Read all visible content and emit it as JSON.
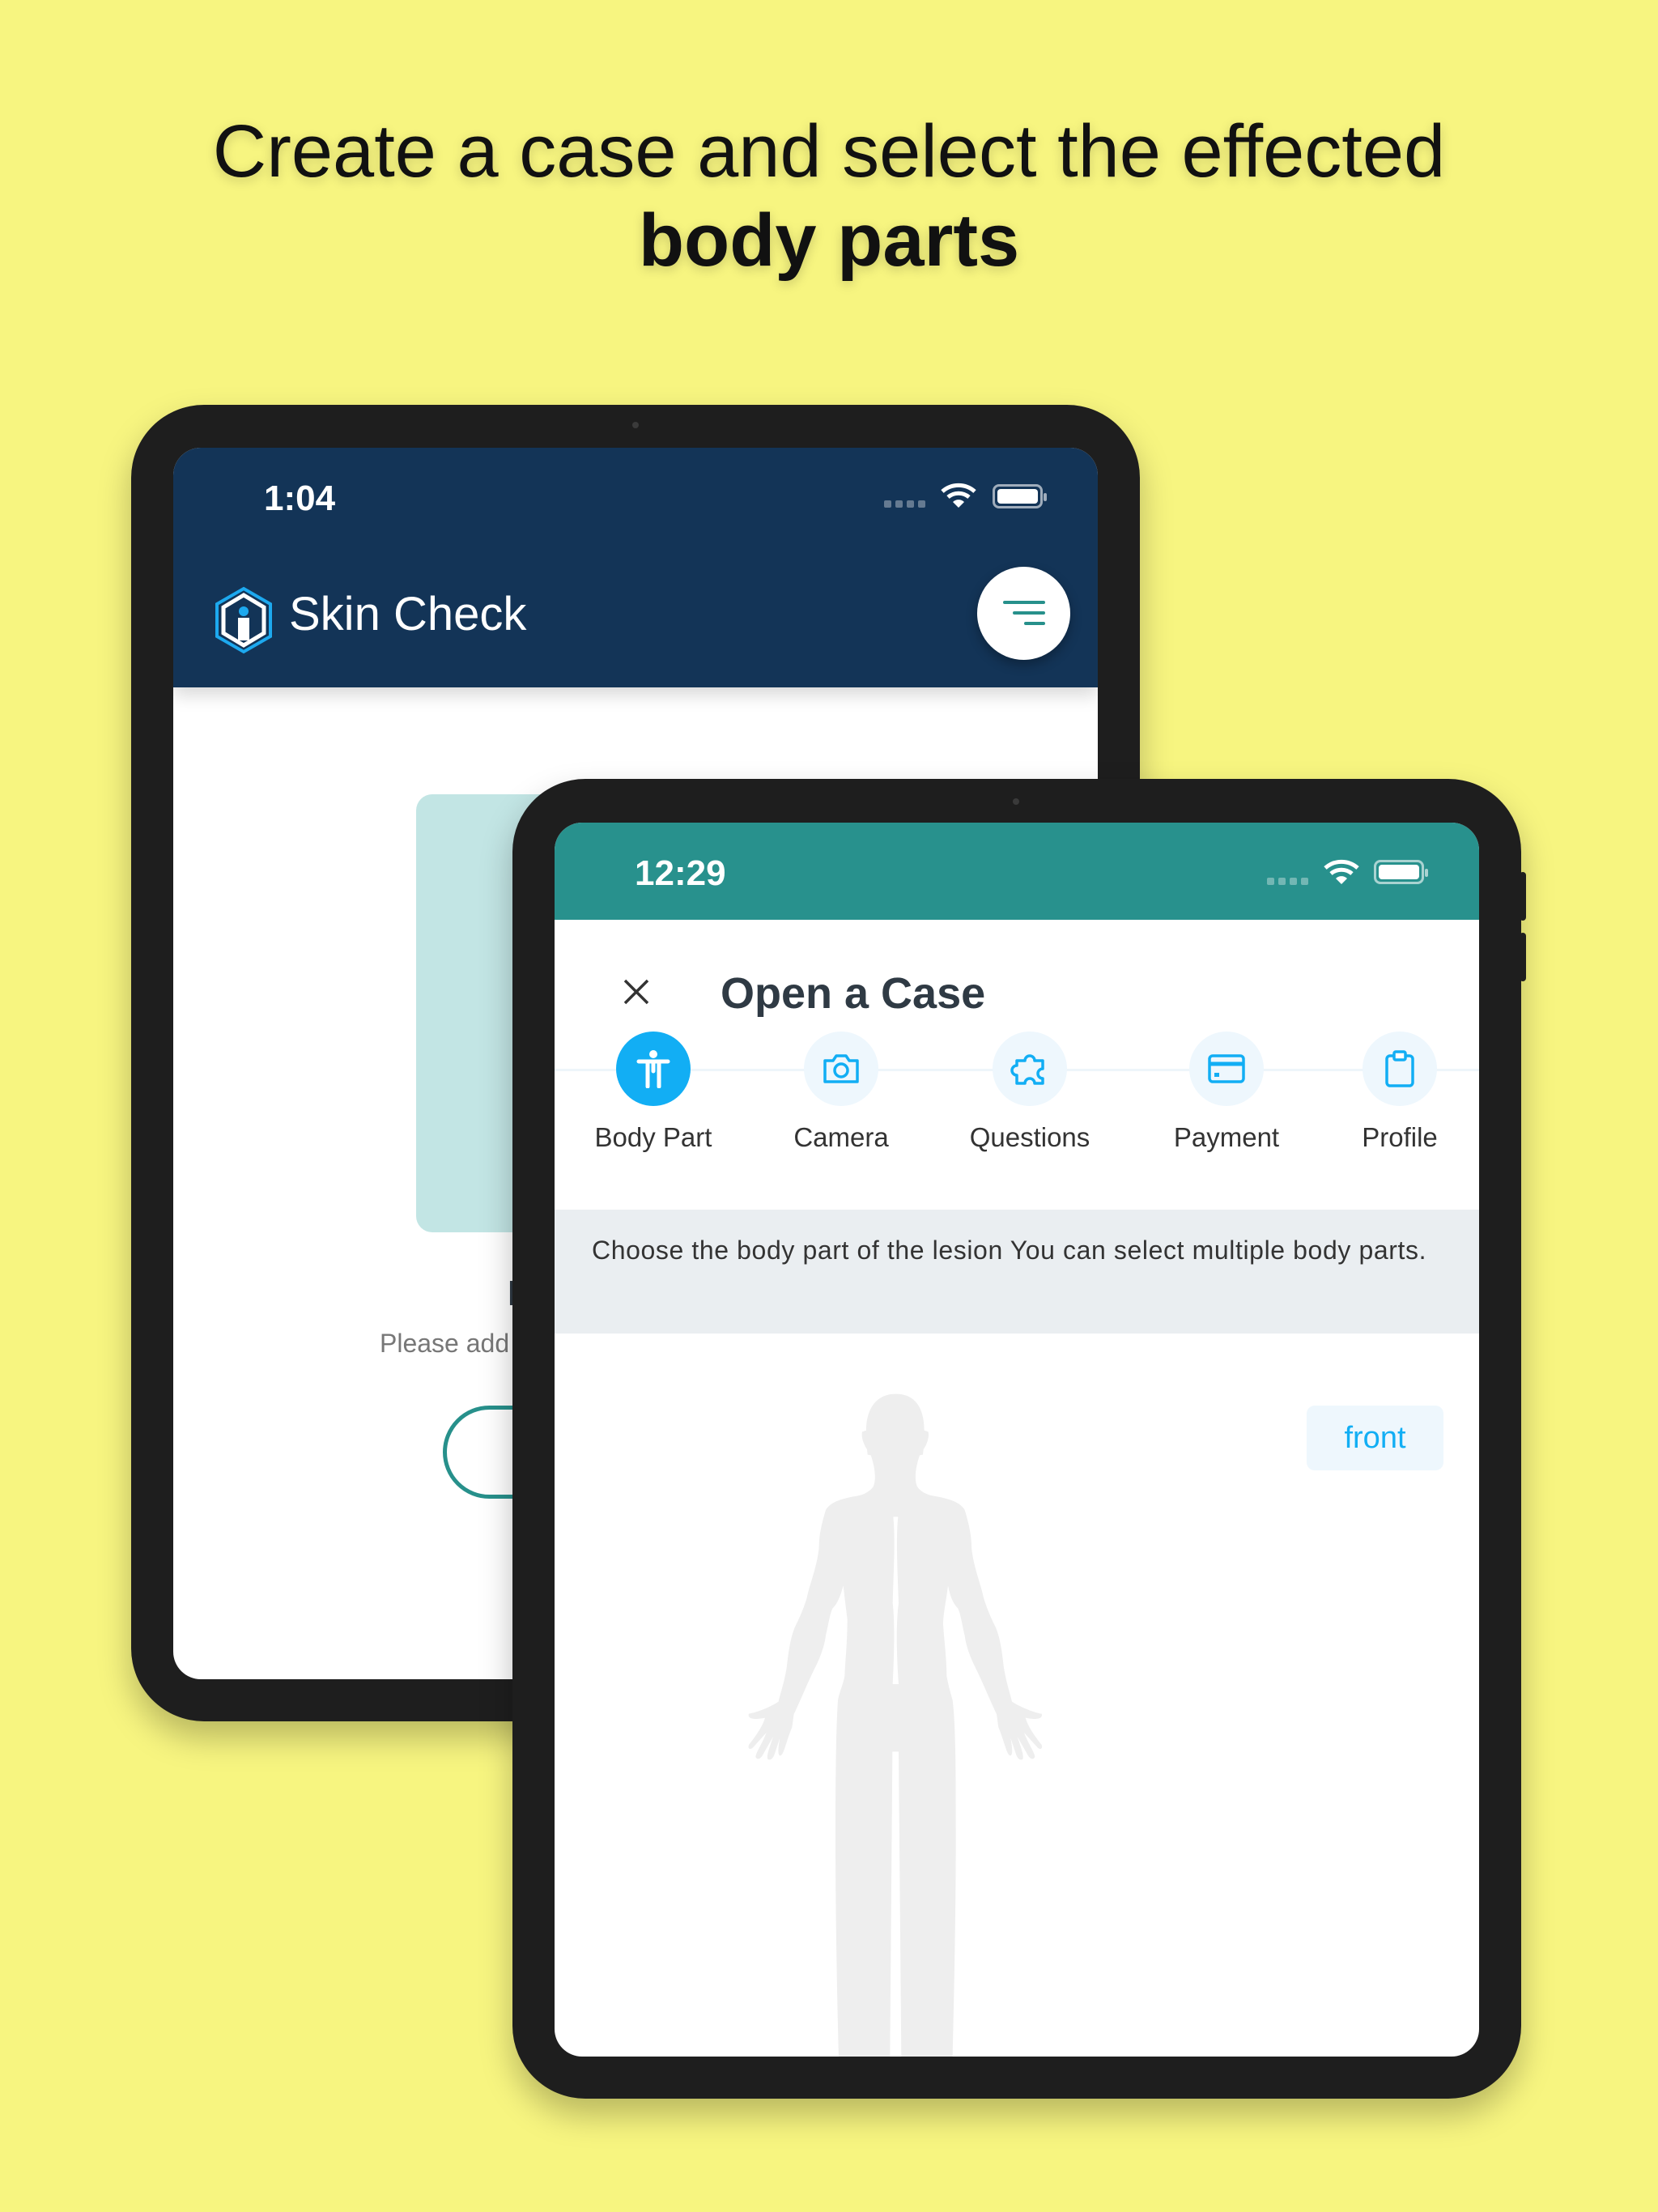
{
  "headline": {
    "line1": "Create a case and select the effected",
    "line2": "body parts"
  },
  "back_device": {
    "status": {
      "time": "1:04"
    },
    "app": {
      "title": "Skin Check",
      "logo": "skin-check-hex-logo",
      "menu_icon": "filter-menu-icon"
    },
    "empty_state": {
      "title_fragment": "N",
      "subtitle_fragment": "Please add"
    },
    "colors": {
      "header": "#133457",
      "card": "#C2E5E4",
      "button_border": "#27908B"
    }
  },
  "front_device": {
    "status": {
      "time": "12:29"
    },
    "page_title": "Open a Case",
    "close_icon": "close-icon",
    "steps": [
      {
        "label": "Body Part",
        "icon": "accessibility-icon",
        "active": true
      },
      {
        "label": "Camera",
        "icon": "camera-icon",
        "active": false
      },
      {
        "label": "Questions",
        "icon": "puzzle-icon",
        "active": false
      },
      {
        "label": "Payment",
        "icon": "credit-card-icon",
        "active": false
      },
      {
        "label": "Profile",
        "icon": "clipboard-icon",
        "active": false
      }
    ],
    "instruction": "Choose the body part of the lesion You can select multiple body parts.",
    "toggle_label": "front",
    "colors": {
      "status_bar": "#28918D",
      "accent": "#12AEF4",
      "instruction_bg": "#EAEEF1",
      "body": "#EEEEEE"
    }
  }
}
